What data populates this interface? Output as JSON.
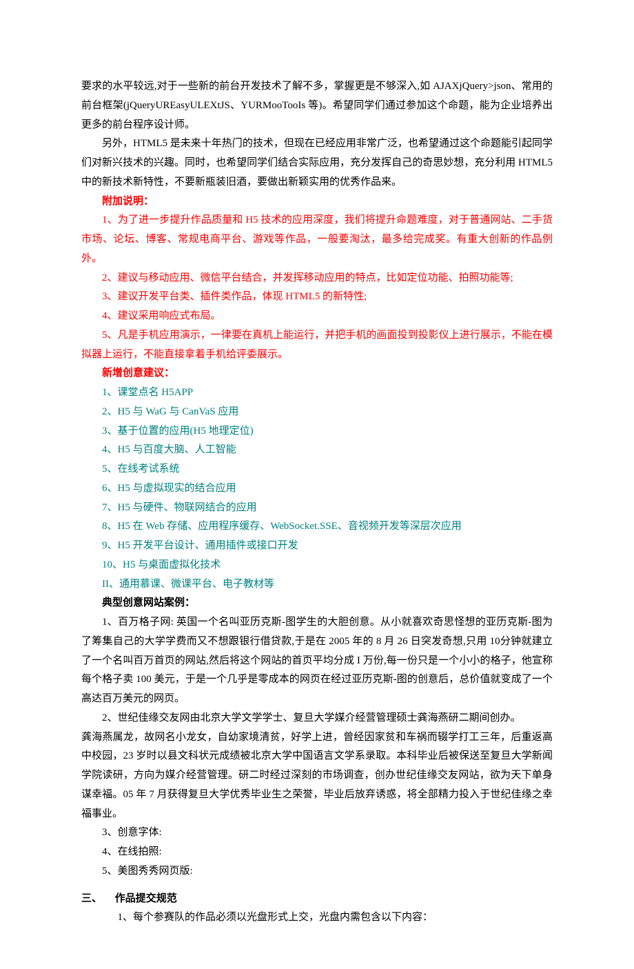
{
  "p1": "要求的水平较远,对于一些新的前台开发技术了解不多，掌握更是不够深入,如 AJAXjQuery>json、常用的前台框架(jQueryUREasyULEXtJS、YURMooTooIs 等)。希望同学们通过参加这个命题，能为企业培养出更多的前台程序设计师。",
  "p2": "另外，HTML5 是未来十年热门的技术，但现在已经应用非常广泛，也希望通过这个命题能引起同学们对新兴技术的兴趣。同时，也希望同学们结合实际应用，充分发挥自己的奇思妙想，充分利用 HTML5 中的新技术新特性，不要新瓶装旧酒，要做出新颖实用的优秀作品来。",
  "h_add": "附加说明：",
  "a1": "1、为了进一步提升作品质量和 H5 技术的应用深度，我们将提升命题难度，对于普通网站、二手货市场、论坛、博客、常规电商平台、游戏等作品，一般要淘汰，最多给完成奖。有重大创新的作品例外。",
  "a2": "2、建议与移动应用、微信平台结合，并发挥移动应用的特点，比如定位功能、拍照功能等;",
  "a3": "3、建议开发平台类、插件类作品，体现 HTML5 的新特性;",
  "a4": "4、建议采用响应式布局。",
  "a5": "5、凡是手机应用演示，一律要在真机上能运行，并把手机的画面投到投影仪上进行展示，不能在模拟器上运行，不能直接拿着手机给评委展示。",
  "h_new": "新增创意建议：",
  "n1": "1、课堂点名 H5APP",
  "n2": "2、H5 与 WaG 与 CanVaS 应用",
  "n3": "3、基于位置的应用(H5 地理定位)",
  "n4": "4、H5 与百度大脑、人工智能",
  "n5": "5、在线考试系统",
  "n6": "6、H5 与虚拟现实的结合应用",
  "n7": "7、H5 与硬件、物联网结合的应用",
  "n8": "8、H5 在 Web 存储、应用程序缓存、WebSocket.SSE、音视频开发等深层次应用",
  "n9": "9、H5 开发平台设计、通用插件或接口开发",
  "n10": "10、H5 与桌面虚拟化技术",
  "n11": "II、通用慕课、微课平台、电子教材等",
  "h_case": "典型创意网站案例：",
  "c1": "1、百万格子网: 英国一个名叫亚历克斯-图学生的大胆创意。从小就喜欢奇思怪想的亚历克斯-图为了筹集自己的大学学费而又不想跟银行借贷款,于是在 2005 年的 8 月 26 日突发奇想,只用 10分钟就建立了一个名叫百万首页的网站,然后将这个网站的首页平均分成 I 万份,每一份只是一个小小的格子，他宣称每个格子卖 100 美元，于是一个几乎是零成本的网页在经过亚历克斯-图的创意后，总价值就变成了一个高达百万美元的网页。",
  "c2a": "2、世纪佳缘交友网由北京大学文学学士、复旦大学媒介经营管理硕士龚海燕研二期间创办。",
  "c2b": "龚海燕属龙，故网名小龙女，自幼家境清贫，好学上进，曾经因家贫和车祸而辍学打工三年，后重返高中校园，23 岁时以县文科状元成绩被北京大学中国语言文学系录取。本科毕业后被保送至复旦大学新闻学院读研，方向为媒介经营管理。研二时经过深刻的市场调查，创办世纪佳缘交友网站，欲为天下单身谋幸福。05 年 7 月获得复旦大学优秀毕业生之荣誉，毕业后放弃诱惑，将全部精力投入于世纪佳缘之幸福事业。",
  "c3": "3、创意字体:",
  "c4": "4、在线拍照:",
  "c5": "5、美图秀秀网页版:",
  "sec_num": "三、",
  "sec_title": "作品提交规范",
  "sub1": "1、每个参赛队的作品必须以光盘形式上交，光盘内需包含以下内容："
}
